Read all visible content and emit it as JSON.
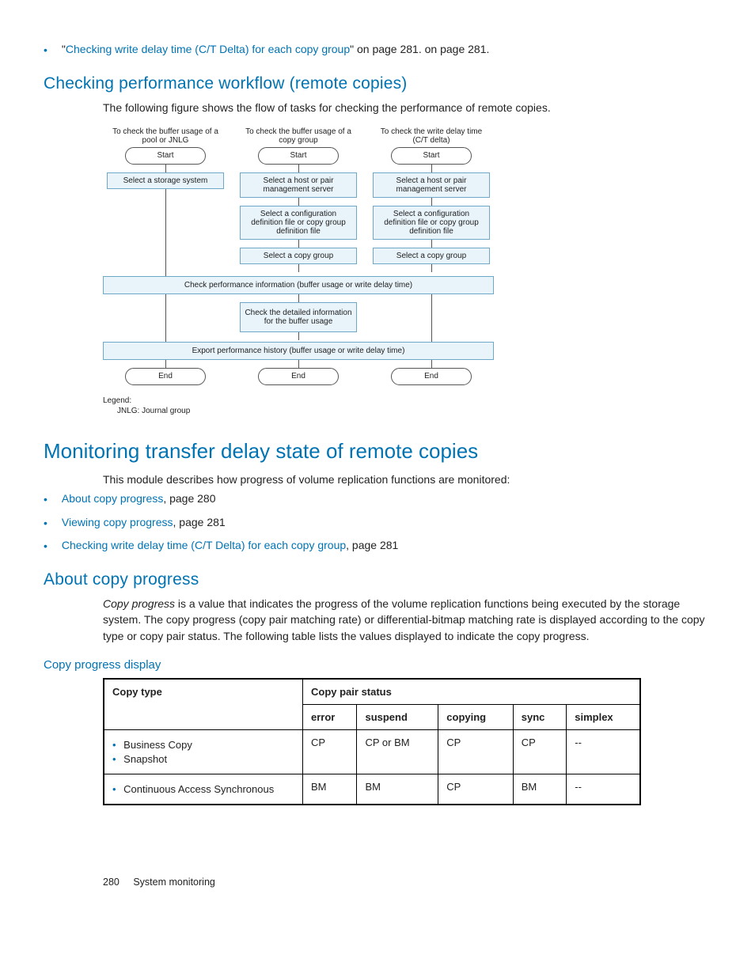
{
  "topBullet": {
    "quoteOpen": "\"",
    "link": "Checking write delay time (C/T Delta) for each copy group",
    "quoteClose": "\" on page 281."
  },
  "sec1": {
    "heading": "Checking performance workflow (remote copies)",
    "intro": "The following figure shows the flow of tasks for checking the performance of remote copies."
  },
  "flow": {
    "col1_head": "To check the buffer usage of a pool or JNLG",
    "col2_head": "To check the buffer usage of a copy group",
    "col3_head": "To check the write delay time (C/T delta)",
    "start": "Start",
    "end": "End",
    "c1_b1": "Select a storage system",
    "c2_b1": "Select a host or pair management server",
    "c2_b2": "Select a configuration definition file or copy group definition file",
    "c2_b3": "Select a copy group",
    "c3_b1": "Select a host or pair management server",
    "c3_b2": "Select a configuration definition file or copy group definition file",
    "c3_b3": "Select a copy group",
    "wide1": "Check performance information (buffer usage or write delay time)",
    "mid": "Check the detailed information for the buffer usage",
    "wide2": "Export performance history (buffer usage or write delay time)",
    "legend": "Legend:",
    "legend_sub": "JNLG: Journal group"
  },
  "sec2": {
    "heading": "Monitoring transfer delay state of remote copies",
    "intro": "This module describes how progress of volume replication functions are monitored:",
    "b1_link": "About copy progress",
    "b1_tail": ", page 280",
    "b2_link": "Viewing copy progress",
    "b2_tail": ", page 281",
    "b3_link": "Checking write delay time (C/T Delta) for each copy group",
    "b3_tail": ", page 281"
  },
  "sec3": {
    "heading": "About copy progress",
    "para_lead": "Copy progress",
    "para_rest": " is a value that indicates the progress of the volume replication functions being executed by the storage system. The copy progress (copy pair matching rate) or differential-bitmap matching rate is displayed according to the copy type or copy pair status. The following table lists the values displayed to indicate the copy progress."
  },
  "sec4": {
    "heading": "Copy progress display"
  },
  "chart_data": {
    "type": "table",
    "header_row1": [
      "Copy type",
      "Copy pair status"
    ],
    "header_row2": [
      "error",
      "suspend",
      "copying",
      "sync",
      "simplex"
    ],
    "rows": [
      {
        "types": [
          "Business Copy",
          "Snapshot"
        ],
        "cells": [
          "CP",
          "CP or BM",
          "CP",
          "CP",
          "--"
        ]
      },
      {
        "types": [
          "Continuous Access Synchronous"
        ],
        "cells": [
          "BM",
          "BM",
          "CP",
          "BM",
          "--"
        ]
      }
    ]
  },
  "footer": {
    "page": "280",
    "title": "System monitoring"
  }
}
